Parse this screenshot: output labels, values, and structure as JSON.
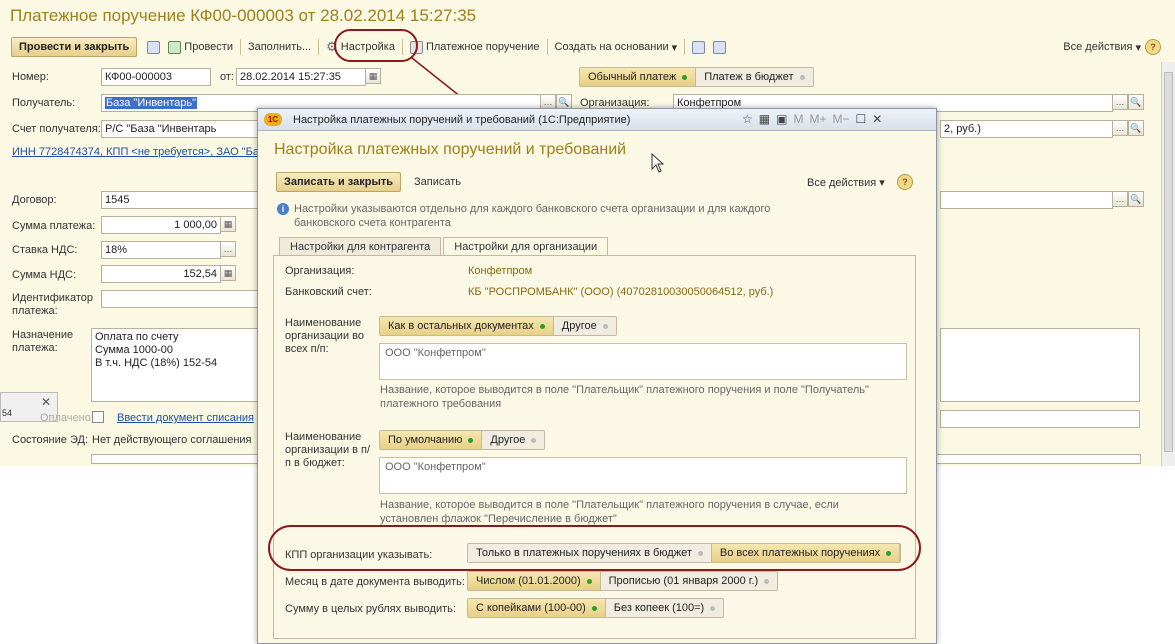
{
  "doc_title": "Платежное поручение КФ00-000003 от 28.02.2014 15:27:35",
  "toolbar": {
    "post_close": "Провести и закрыть",
    "post": "Провести",
    "fill": "Заполнить...",
    "settings": "Настройка",
    "pp": "Платежное поручение",
    "create_on": "Создать на основании",
    "all_actions": "Все действия"
  },
  "form": {
    "number_label": "Номер:",
    "number": "КФ00-000003",
    "from_label": "от:",
    "date": "28.02.2014 15:27:35",
    "payment_types": [
      "Обычный платеж",
      "Платеж в бюджет"
    ],
    "recipient_label": "Получатель:",
    "recipient": "База \"Инвентарь\"",
    "org_label": "Организация:",
    "org": "Конфетпром",
    "account_label": "Счет получателя:",
    "account": "Р/С \"База \"Инвентарь",
    "account_right": "2, руб.)",
    "inn_link": "ИНН 7728474374, КПП <не требуется>, ЗАО \"Ба",
    "contract_label": "Договор:",
    "contract": "1545",
    "sum_label": "Сумма платежа:",
    "sum": "1 000,00",
    "vat_rate_label": "Ставка НДС:",
    "vat_rate": "18%",
    "vat_sum_label": "Сумма НДС:",
    "vat_sum": "152,54",
    "ident_label": "Идентификатор платежа:",
    "purpose_label": "Назначение платежа:",
    "purpose_lines": [
      "Оплата по счету",
      "Сумма 1000-00",
      "В т.ч. НДС  (18%) 152-54"
    ],
    "paid_label": "Оплачено:",
    "enter_doc_link": "Ввести документ списания",
    "edo_label": "Состояние ЭД:",
    "edo_value": "Нет действующего соглашения",
    "side_num": "54"
  },
  "dialog": {
    "window_title": "Настройка платежных поручений и требований  (1С:Предприятие)",
    "header": "Настройка платежных поручений и требований",
    "save_close": "Записать и закрыть",
    "save": "Записать",
    "all_actions": "Все действия",
    "info": "Настройки указываются отдельно для каждого банковского счета организации и для каждого банковского счета контрагента",
    "tabs": [
      "Настройки для контрагента",
      "Настройки для организации"
    ],
    "org_label": "Организация:",
    "org_value": "Конфетпром",
    "bank_label": "Банковский счет:",
    "bank_value": "КБ \"РОСПРОМБАНК\" (ООО) (40702810030050064512, руб.)",
    "name_all_label": "Наименование организации во всех п/п:",
    "name_all_options": [
      "Как в остальных документах",
      "Другое"
    ],
    "name_all_value": "ООО \"Конфетпром\"",
    "name_all_hint": "Название, которое выводится в поле \"Плательщик\" платежного поручения и поле \"Получатель\" платежного требования",
    "name_budget_label": "Наименование организации в п/п в бюджет:",
    "name_budget_options": [
      "По умолчанию",
      "Другое"
    ],
    "name_budget_value": "ООО \"Конфетпром\"",
    "name_budget_hint": "Название, которое выводится в поле \"Плательщик\" платежного поручения в случае, если установлен флажок \"Перечисление в бюджет\"",
    "kpp_label": "КПП организации указывать:",
    "kpp_options": [
      "Только в платежных поручениях в бюджет",
      "Во всех платежных поручениях"
    ],
    "month_label": "Месяц в дате документа выводить:",
    "month_options": [
      "Числом (01.01.2000)",
      "Прописью (01 января 2000 г.)"
    ],
    "rubles_label": "Сумму в целых рублях выводить:",
    "rubles_options": [
      "С копейками (100-00)",
      "Без копеек (100=)"
    ]
  }
}
